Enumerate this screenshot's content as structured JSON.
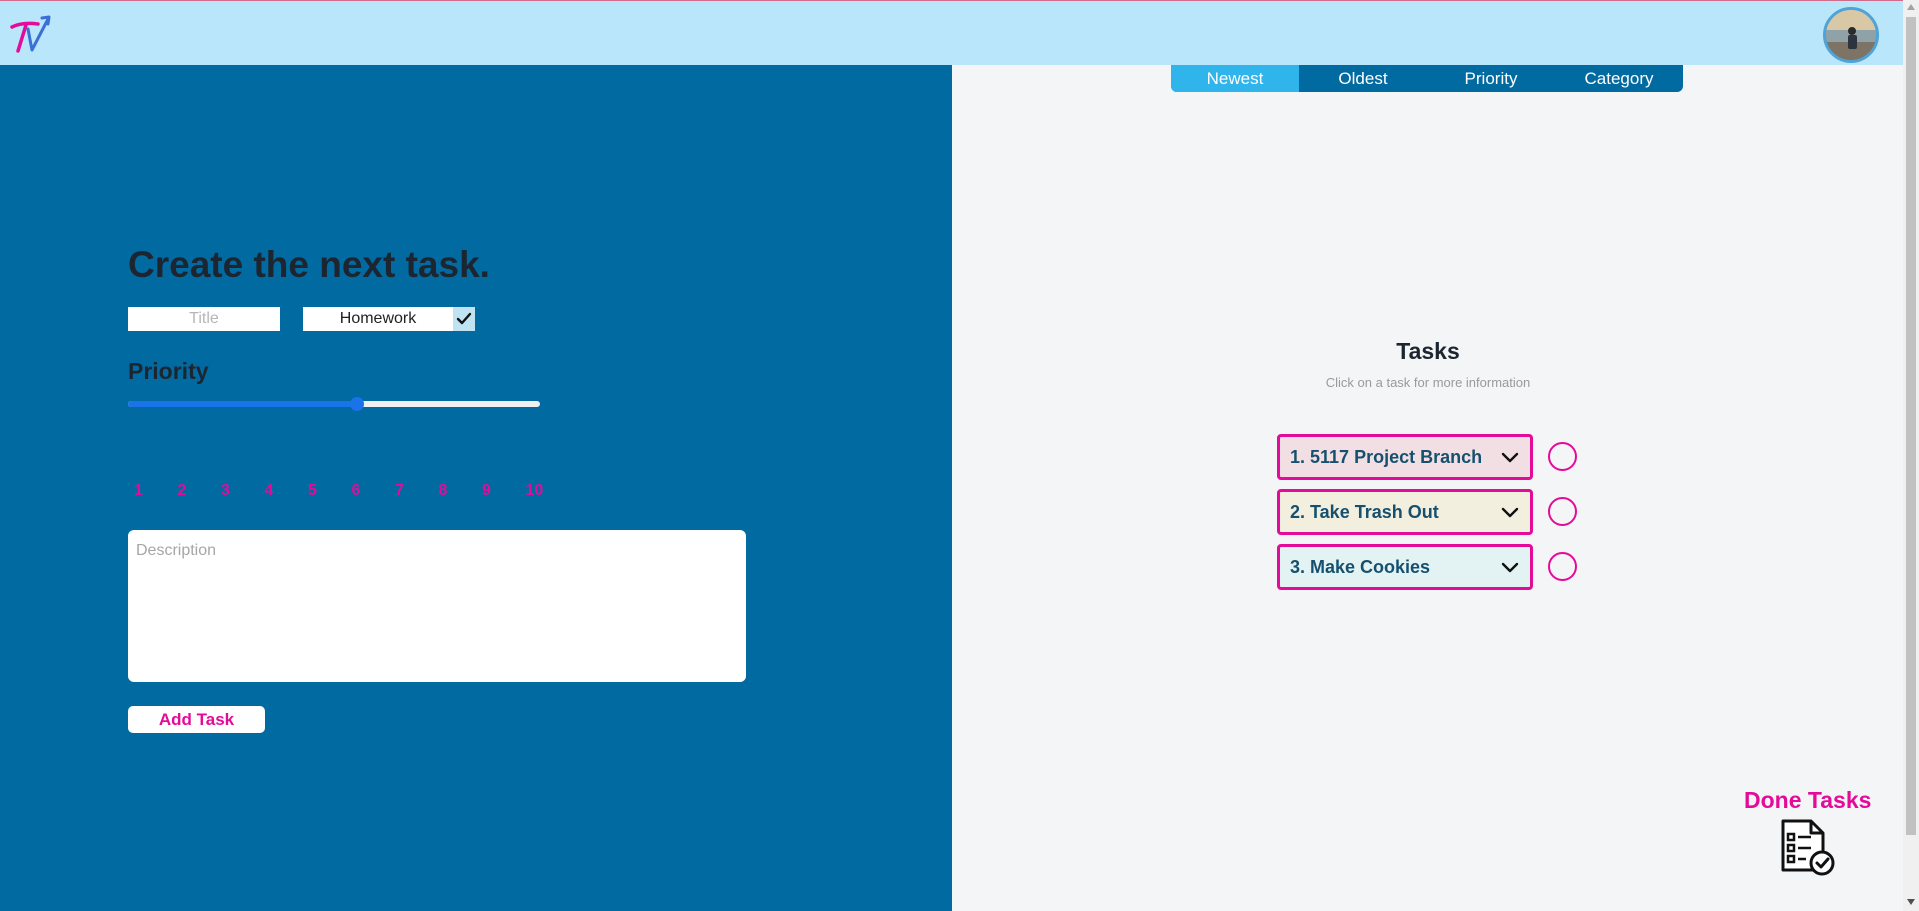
{
  "header": {
    "logo_icon": "tv-logo-icon",
    "avatar_icon": "user-avatar"
  },
  "create": {
    "heading": "Create the next task.",
    "title_placeholder": "Title",
    "category_value": "Homework",
    "priority_label": "Priority",
    "priority_value": 6,
    "priority_ticks": [
      "1",
      "2",
      "3",
      "4",
      "5",
      "6",
      "7",
      "8",
      "9",
      "10"
    ],
    "description_placeholder": "Description",
    "add_button": "Add Task"
  },
  "sort": {
    "tabs": [
      "Newest",
      "Oldest",
      "Priority",
      "Category"
    ],
    "active": "Newest"
  },
  "tasks": {
    "heading": "Tasks",
    "subtitle": "Click on a task for more information",
    "items": [
      {
        "label": "1. 5117 Project Branch",
        "bg": "#f1dfe4"
      },
      {
        "label": "2. Take Trash Out",
        "bg": "#f2efdf"
      },
      {
        "label": "3. Make Cookies",
        "bg": "#e3f3f3"
      }
    ]
  },
  "done": {
    "label": "Done Tasks",
    "icon": "checklist-done-icon"
  },
  "colors": {
    "header_bg": "#b9e6fb",
    "panel_blue": "#006aa1",
    "accent_pink": "#e40b9a",
    "tab_active": "#2fb5ec",
    "slider_blue": "#1a73e8"
  }
}
